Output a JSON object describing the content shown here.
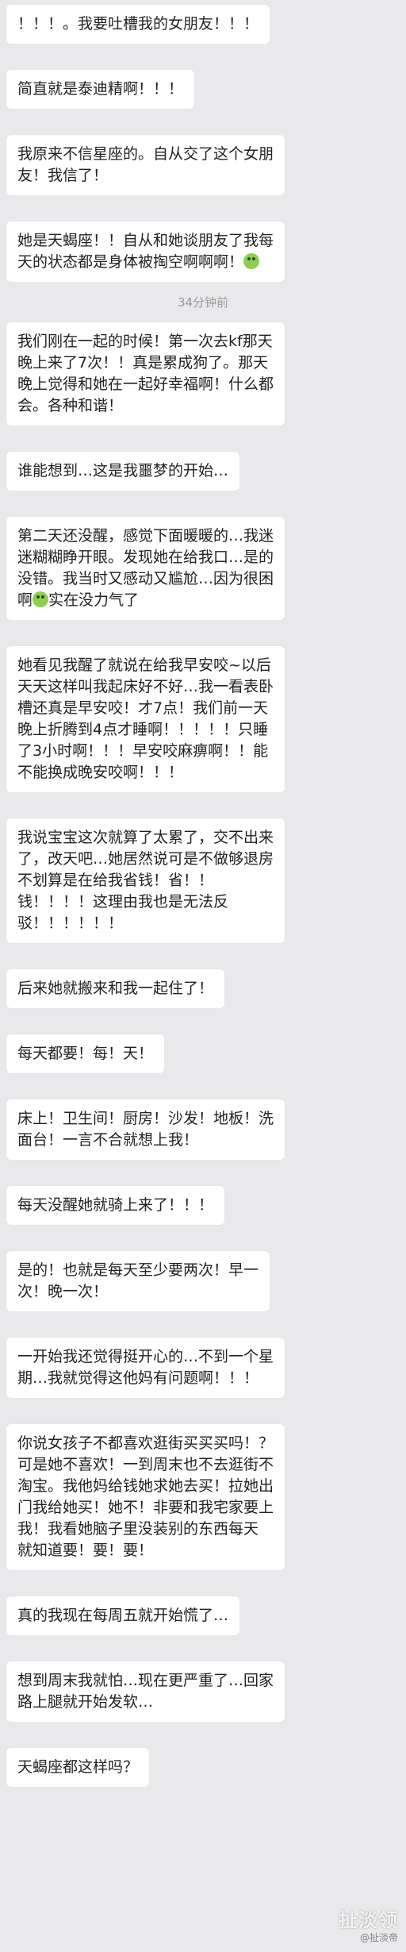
{
  "messages": [
    {
      "text": "！！！。我要吐槽我的女朋友！！！"
    },
    {
      "text": "简直就是泰迪精啊！！！"
    },
    {
      "text": "我原来不信星座的。自从交了这个女朋\n友！我信了！"
    },
    {
      "text": "她是天蝎座！！自从和她谈朋友了我每\n天的状态都是身体被掏空啊啊啊！",
      "emoji_after": "green-face-emoji"
    },
    {
      "text": "我们刚在一起的时候！第一次去kf那天\n晚上来了7次！！真是累成狗了。那天\n晚上觉得和她在一起好幸福啊！什么都\n会。各种和谐！"
    },
    {
      "text": "谁能想到…这是我噩梦的开始…"
    },
    {
      "text": "第二天还没醒，感觉下面暖暖的…我迷\n迷糊糊睁开眼。发现她在给我口…是的\n没错。我当时又感动又尴尬…因为很困\n啊",
      "emoji_inline": "green-face-emoji",
      "text_after": "实在没力气了"
    },
    {
      "text": "她看见我醒了就说在给我早安咬~以后\n天天这样叫我起床好不好…我一看表卧\n槽还真是早安咬！才7点！我们前一天\n晚上折腾到4点才睡啊！！！！！只睡\n了3小时啊！！！早安咬麻痹啊！！能\n不能换成晚安咬啊！！！"
    },
    {
      "text": "我说宝宝这次就算了太累了，交不出来\n了，改天吧…她居然说可是不做够退房\n不划算是在给我省钱！省！！\n钱！！！！这理由我也是无法反\n驳！！！！！！"
    },
    {
      "text": "后来她就搬来和我一起住了！"
    },
    {
      "text": "每天都要！每！天！"
    },
    {
      "text": "床上！卫生间！厨房！沙发！地板！洗\n面台！一言不合就想上我！"
    },
    {
      "text": "每天没醒她就骑上来了！！！"
    },
    {
      "text": "是的！也就是每天至少要两次！早一\n次！晚一次！"
    },
    {
      "text": "一开始我还觉得挺开心的…不到一个星\n期…我就觉得这他妈有问题啊！！！"
    },
    {
      "text": "你说女孩子不都喜欢逛街买买买吗！？\n可是她不喜欢！一到周末也不去逛街不\n淘宝。我他妈给钱她求她去买！拉她出\n门我给她买！她不！非要和我宅家要上\n我！我看她脑子里没装别的东西每天\n就知道要！要！要！"
    },
    {
      "text": "真的我现在每周五就开始慌了…"
    },
    {
      "text": "想到周末我就怕…现在更严重了…回家\n路上腿就开始发软…"
    },
    {
      "text": "天蝎座都这样吗？"
    }
  ],
  "timestamp": "34分钟前",
  "watermark": {
    "logo": "扯淡领",
    "handle": "@扯淡帝"
  },
  "colors": {
    "background": "#e9e9ec",
    "bubble": "#ffffff",
    "text": "#222222",
    "timestamp": "#9a9a9a"
  }
}
